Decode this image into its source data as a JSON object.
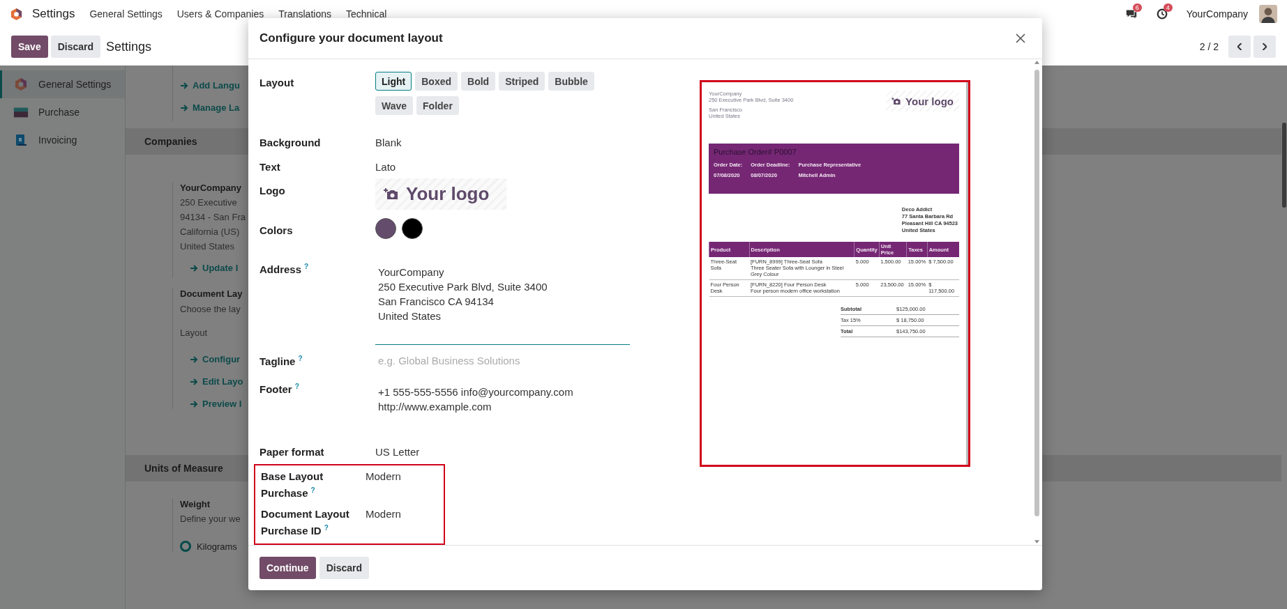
{
  "navbar": {
    "app": "Settings",
    "menus": [
      "General Settings",
      "Users & Companies",
      "Translations",
      "Technical"
    ],
    "messages_badge": "6",
    "activity_badge": "4",
    "company": "YourCompany"
  },
  "control_panel": {
    "save": "Save",
    "discard": "Discard",
    "breadcrumb": "Settings",
    "pager": "2 / 2"
  },
  "sidebar": {
    "items": [
      {
        "label": "General Settings",
        "selected": true
      },
      {
        "label": "Purchase",
        "selected": false
      },
      {
        "label": "Invoicing",
        "selected": false
      }
    ]
  },
  "settings": {
    "top_links": [
      "Add Langu",
      "Manage La"
    ],
    "companies": {
      "title": "Companies",
      "company": "YourCompany",
      "address": [
        "250 Executive",
        "94134 - San Fra",
        "California (US)",
        "United States"
      ],
      "link": "Update I"
    },
    "document_layout": {
      "title": "Document Lay",
      "description": "Choose the lay",
      "sub_label": "Layout",
      "links": [
        "Configur",
        "Edit Layo",
        "Preview I"
      ]
    },
    "units": {
      "title": "Units of Measure",
      "setting": "Weight",
      "description": "Define your we",
      "option": {
        "label": "Kilograms",
        "selected": true
      }
    }
  },
  "dialog": {
    "title": "Configure your document layout",
    "fields": [
      {
        "kind": "layouts",
        "label": "Layout",
        "options": [
          {
            "label": "Light",
            "selected": true
          },
          {
            "label": "Boxed",
            "selected": false
          },
          {
            "label": "Bold",
            "selected": false
          },
          {
            "label": "Striped",
            "selected": false
          },
          {
            "label": "Bubble",
            "selected": false
          },
          {
            "label": "Wave",
            "selected": false
          },
          {
            "label": "Folder",
            "selected": false
          }
        ]
      },
      {
        "kind": "value",
        "label": "Background",
        "value": "Blank"
      },
      {
        "kind": "value",
        "label": "Text",
        "value": "Lato"
      },
      {
        "kind": "logo",
        "label": "Logo",
        "logo_text": "Your logo"
      },
      {
        "kind": "colors",
        "label": "Colors",
        "swatches": [
          {
            "color": "#644c6d"
          },
          {
            "color": "#000000"
          }
        ]
      },
      {
        "kind": "textarea",
        "label": "Address",
        "help": "?",
        "lines": [
          "YourCompany",
          "250 Executive Park Blvd, Suite 3400",
          "San Francisco CA 94134",
          "United States"
        ],
        "focused": true
      },
      {
        "kind": "input",
        "label": "Tagline",
        "help": "?",
        "placeholder": "e.g. Global Business Solutions"
      },
      {
        "kind": "textarea",
        "label": "Footer",
        "help": "?",
        "lines": [
          "+1 555-555-5556 info@yourcompany.com",
          "http://www.example.com"
        ],
        "focused": false
      },
      {
        "kind": "value",
        "label": "Paper format",
        "value": "US Letter"
      }
    ],
    "highlighted_fields": [
      {
        "label": "Base Layout Purchase",
        "help": "?",
        "value": "Modern"
      },
      {
        "label": "Document Layout Purchase ID",
        "help": "?",
        "value": "Modern"
      }
    ],
    "preview": {
      "highlighted": true,
      "company_lines": [
        "YourCompany",
        "250 Executive Park Blvd, Suite 3400"
      ],
      "city_lines": [
        "San Francisco",
        "United States"
      ],
      "logo_text": "Your logo",
      "title": "Purchase Order# P0007",
      "info": [
        {
          "label": "Order Date:",
          "value": "07/08/2020"
        },
        {
          "label": "Order Deadline:",
          "value": "08/07/2020"
        },
        {
          "label": "Purchase Representative",
          "value": "Mitchell Admin"
        }
      ],
      "customer": [
        "Deco Addict",
        "77 Santa Barbara Rd",
        "Pleasant Hill CA 94523",
        "United States"
      ],
      "columns": [
        "Product",
        "Description",
        "Quantity",
        "Unit Price",
        "Taxes",
        "Amount"
      ],
      "rows": [
        {
          "product": "Three-Seat Sofa",
          "description": "[FURN_8999] Three-Seat Sofa",
          "note": "Three Seater Sofa with Lounger in Steel Grey Colour",
          "quantity": "5.000",
          "unit_price": "1,500.00",
          "taxes": "15.00%",
          "amount": "$ 7,500.00"
        },
        {
          "product": "Four Person Desk",
          "description": "[FURN_8220] Four Person Desk",
          "note": "Four person modern office workstation",
          "quantity": "5.000",
          "unit_price": "23,500.00",
          "taxes": "15.00%",
          "amount": "$ 117,500.00"
        }
      ],
      "totals": [
        {
          "label": "Subtotal",
          "value": "$125,000.00",
          "bold": true
        },
        {
          "label": "Tax 15%",
          "value": "$ 18,750.00",
          "bold": false
        },
        {
          "label": "Total",
          "value": "$143,750.00",
          "bold": true
        }
      ]
    },
    "buttons": {
      "primary": "Continue",
      "secondary": "Discard"
    }
  }
}
